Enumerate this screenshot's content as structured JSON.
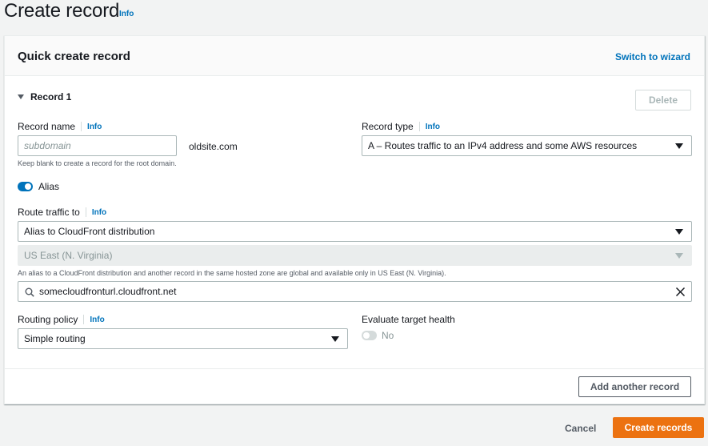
{
  "page": {
    "title": "Create record",
    "info": "Info"
  },
  "panel": {
    "title": "Quick create record",
    "switch_wizard": "Switch to wizard"
  },
  "record": {
    "expander_label": "Record 1",
    "delete_label": "Delete",
    "record_name": {
      "label": "Record name",
      "info": "Info",
      "placeholder": "subdomain",
      "value": "",
      "suffix": "oldsite.com",
      "hint": "Keep blank to create a record for the root domain."
    },
    "record_type": {
      "label": "Record type",
      "info": "Info",
      "selected": "A – Routes traffic to an IPv4 address and some AWS resources"
    },
    "alias": {
      "label": "Alias",
      "enabled": true
    },
    "route_traffic": {
      "label": "Route traffic to",
      "info": "Info",
      "endpoint": "Alias to CloudFront distribution",
      "region": "US East (N. Virginia)",
      "hint": "An alias to a CloudFront distribution and another record in the same hosted zone are global and available only in US East (N. Virginia).",
      "target": "somecloudfronturl.cloudfront.net"
    },
    "routing_policy": {
      "label": "Routing policy",
      "info": "Info",
      "selected": "Simple routing"
    },
    "evaluate_health": {
      "label": "Evaluate target health",
      "toggle_label": "No",
      "enabled": false
    }
  },
  "add_another_label": "Add another record",
  "footer": {
    "cancel_label": "Cancel",
    "create_label": "Create records"
  },
  "colors": {
    "link": "#0073bb",
    "primary_button": "#ec7211",
    "toggle_on": "#0073bb"
  }
}
